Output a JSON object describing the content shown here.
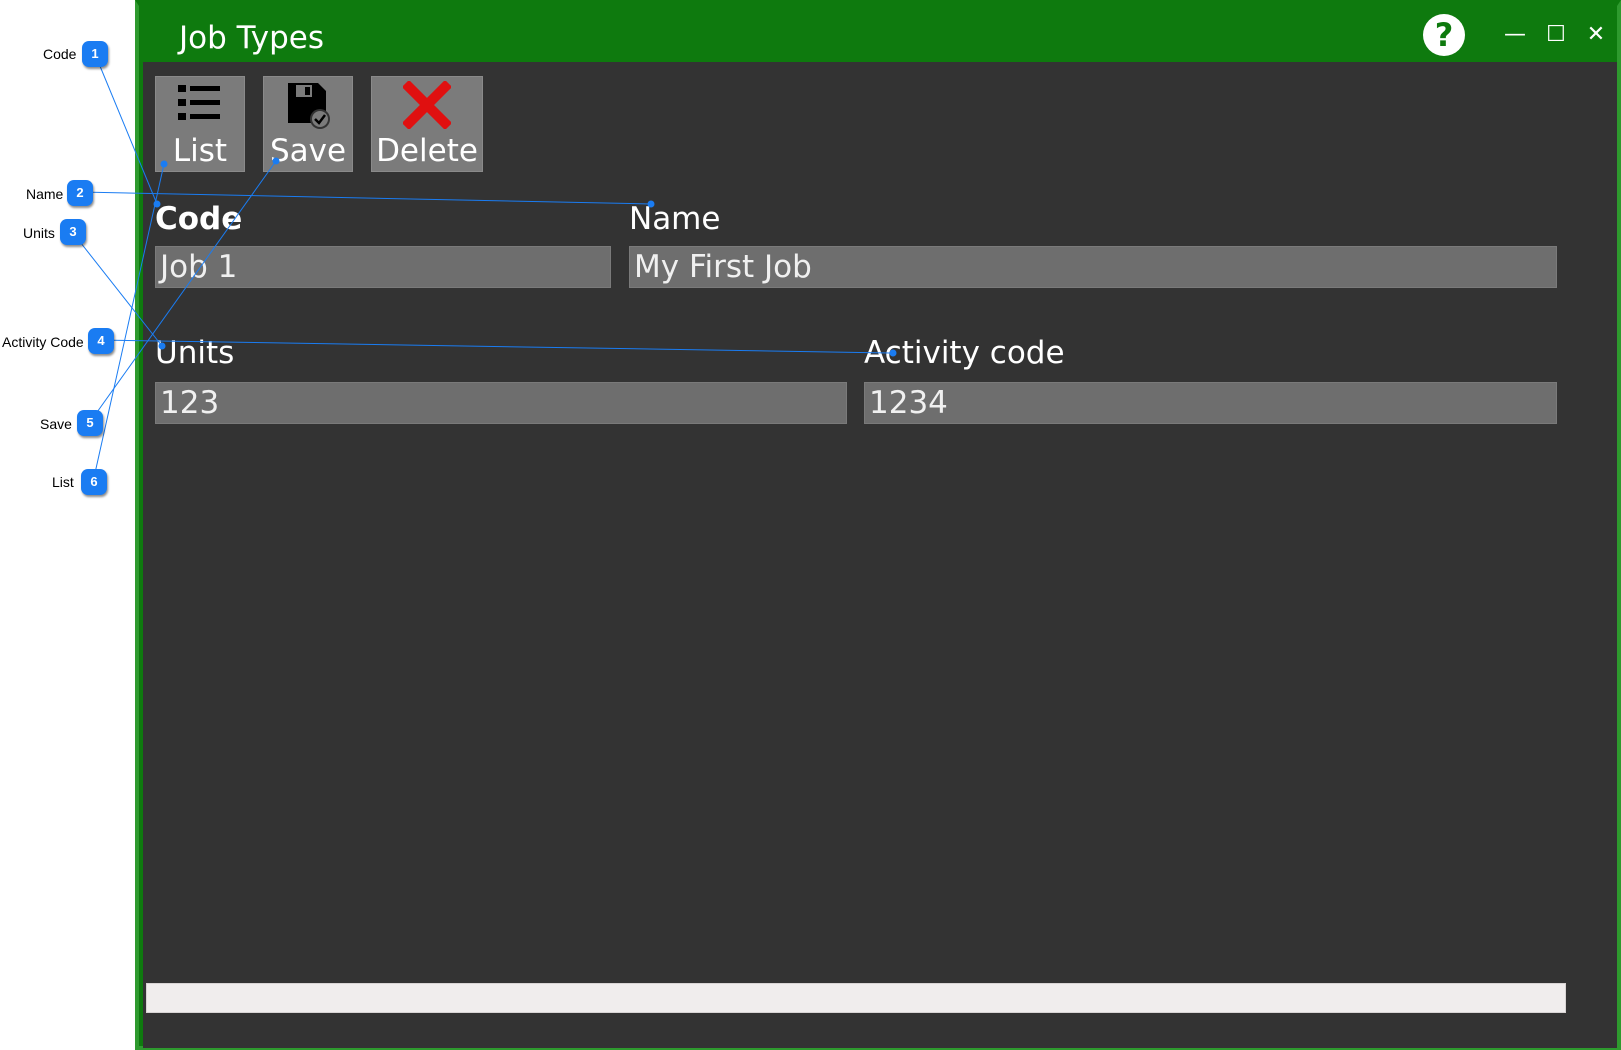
{
  "window": {
    "title": "Job Types",
    "help_glyph": "?",
    "minimize_glyph": "—",
    "maximize_glyph": "☐",
    "close_glyph": "✕"
  },
  "toolbar": {
    "list_label": "List",
    "save_label": "Save",
    "delete_label": "Delete"
  },
  "form": {
    "code_label": "Code",
    "code_value": "Job 1",
    "name_label": "Name",
    "name_value": "My First Job",
    "units_label": "Units",
    "units_value": "123",
    "activity_label": "Activity code",
    "activity_value": "1234"
  },
  "callouts": [
    {
      "number": "1",
      "label": "Code"
    },
    {
      "number": "2",
      "label": "Name"
    },
    {
      "number": "3",
      "label": "Units"
    },
    {
      "number": "4",
      "label": "Activity Code"
    },
    {
      "number": "5",
      "label": "Save"
    },
    {
      "number": "6",
      "label": "List"
    }
  ],
  "colors": {
    "title_bar": "#0e7a0e",
    "content_bg": "#333333",
    "input_bg": "#6e6e6e",
    "button_bg": "#7b7b7b",
    "badge": "#1a7cf2",
    "callout_line": "#1a7cf2",
    "delete_icon": "#e01010"
  }
}
